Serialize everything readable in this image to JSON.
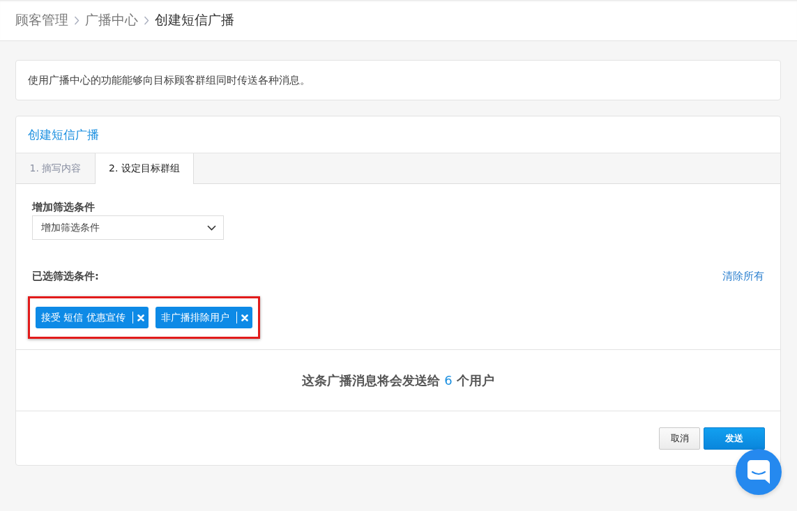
{
  "breadcrumb": [
    {
      "label": "顾客管理",
      "current": false
    },
    {
      "label": "广播中心",
      "current": false
    },
    {
      "label": "创建短信广播",
      "current": true
    }
  ],
  "notice": {
    "text": "使用广播中心的功能能够向目标顾客群组同时传送各种消息。"
  },
  "panel": {
    "title": "创建短信广播",
    "tabs": [
      {
        "label": "1. 摘写内容",
        "selected": false
      },
      {
        "label": "2. 设定目标群组",
        "selected": true
      }
    ],
    "filter_select": {
      "label": "增加筛选条件",
      "value": "增加筛选条件"
    },
    "selected_filters": {
      "label": "已选筛选条件:",
      "clear_link": "清除所有",
      "highlighted": true,
      "chips": [
        {
          "label": "接受 短信 优惠宣传"
        },
        {
          "label": "非广播排除用户"
        }
      ]
    },
    "summary": {
      "text_before": "这条广播消息将会发送给",
      "count": "6",
      "text_after": "个用户"
    },
    "buttons": [
      {
        "label": "取消",
        "kind": "secondary"
      },
      {
        "label": "发送",
        "kind": "primary"
      }
    ]
  }
}
